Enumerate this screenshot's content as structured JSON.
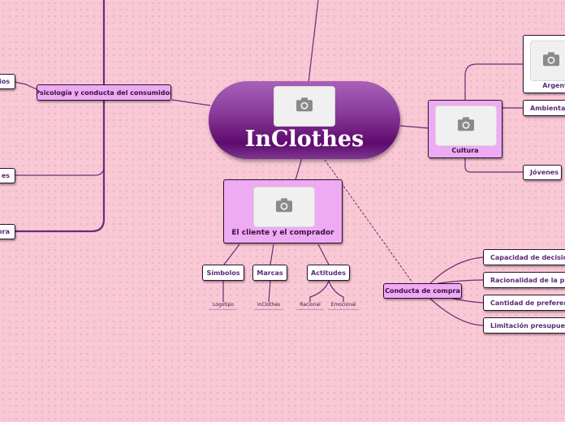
{
  "central": {
    "title": "InClothes"
  },
  "left": {
    "main": "Psicología y conducta del consumidor",
    "items": [
      "ios",
      "es",
      "ora"
    ]
  },
  "right_culture": {
    "main": "Cultura",
    "items": [
      "Argent",
      "Ambientalis",
      "Jóvenes"
    ]
  },
  "client": {
    "main": "El cliente y el comprador",
    "children": [
      {
        "label": "Símbolos",
        "leaves": [
          "Logotipo"
        ]
      },
      {
        "label": "Marcas",
        "leaves": [
          "InClothes"
        ]
      },
      {
        "label": "Actitudes",
        "leaves": [
          "Racional",
          "Emocional"
        ]
      }
    ]
  },
  "purchase": {
    "main": "Conducta de compra",
    "items": [
      "Capacidad de decisión",
      "Racionalidad de la prefe",
      "Cantidad de preferencia",
      "Limitación presupuestar"
    ]
  },
  "colors": {
    "accent": "#eeaaf2",
    "line": "#6a2a78",
    "central": "#7e2a90"
  },
  "icons": {
    "image_placeholder": "camera-icon"
  }
}
